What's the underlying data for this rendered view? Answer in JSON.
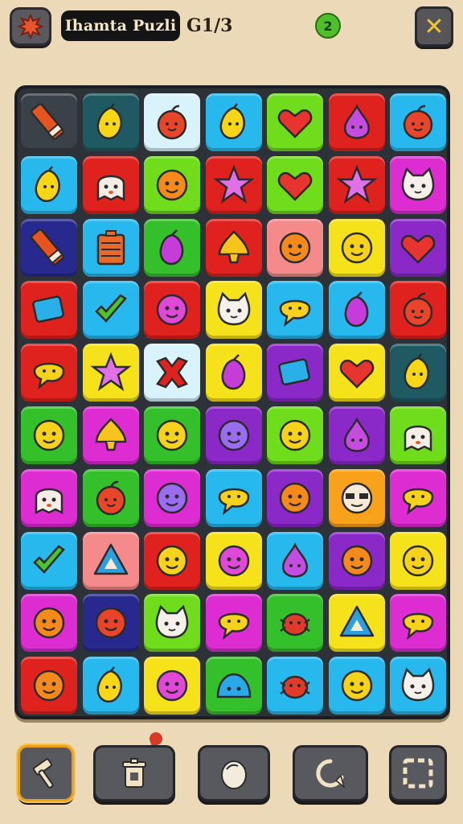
{
  "header": {
    "title": "Ihamta Puzli",
    "moves": "G1/3",
    "coin_label": "2"
  },
  "icons": {
    "menu": "splat-icon",
    "close": "close-x-icon"
  },
  "colors": {
    "background": "#ecd9b8",
    "board": "#2d3238",
    "accent": "#f0c634"
  },
  "board": {
    "rows": 10,
    "cols": 7,
    "tiles": [
      [
        "dark-grey:pencil",
        "dark-teal:lemon",
        "white-blue:apple",
        "sky:lemon",
        "lime:heart",
        "red:drop",
        "sky:apple"
      ],
      [
        "sky:lemon",
        "red:ghost",
        "lime:face-orange",
        "red:star",
        "lime:heart",
        "red:star",
        "magenta:cat"
      ],
      [
        "navy:pencil",
        "sky:battery",
        "green:grape",
        "red:bell",
        "pink:face-orange",
        "yellow:face",
        "purple:heart"
      ],
      [
        "red:block",
        "sky:check",
        "red:face-pink",
        "yellow:cat",
        "sky:bubble",
        "sky:grape",
        "red:apple"
      ],
      [
        "red:bubble",
        "yellow:star",
        "white-blue:cross",
        "yellow:grape",
        "purple:block",
        "yellow:heart",
        "dark-teal:lemon"
      ],
      [
        "green:face",
        "magenta:bell",
        "green:face",
        "purple:face-purple",
        "lime:face",
        "purple:drop",
        "lime:ghost"
      ],
      [
        "magenta:ghost",
        "green:apple",
        "magenta:face-purple",
        "sky:bubble",
        "purple:face-orange",
        "orange:glasses",
        "magenta:bubble"
      ],
      [
        "sky:check",
        "pink:triangle",
        "red:face",
        "yellow:face-pink",
        "sky:drop",
        "purple:face-orange",
        "yellow:face"
      ],
      [
        "magenta:face-orange",
        "navy:face-red",
        "lime:cat",
        "magenta:bubble",
        "green:bug",
        "yellow:triangle",
        "magenta:bubble"
      ],
      [
        "red:face-orange",
        "sky:lemon",
        "yellow:face-pink",
        "green:blob",
        "sky:bug",
        "sky:face",
        "sky:cat"
      ]
    ]
  },
  "toolbar": {
    "tools": [
      {
        "name": "hammer-icon",
        "selected": true
      },
      {
        "name": "trash-icon",
        "selected": false
      },
      {
        "name": "egg-icon",
        "selected": false
      },
      {
        "name": "rotate-icon",
        "selected": false
      },
      {
        "name": "frame-icon",
        "selected": false
      }
    ]
  }
}
